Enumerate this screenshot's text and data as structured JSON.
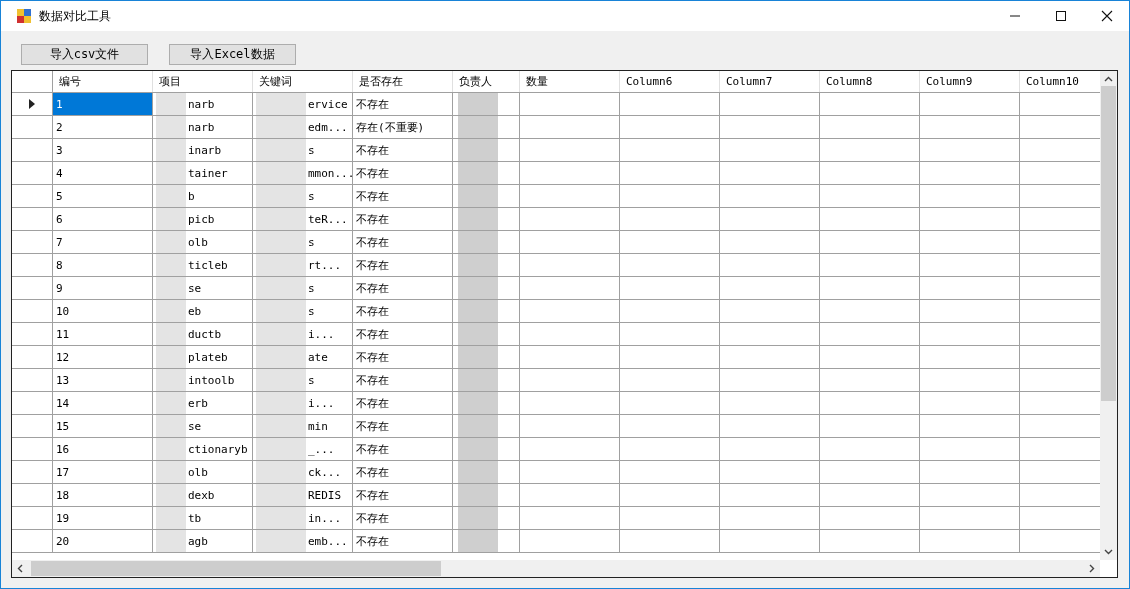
{
  "window": {
    "title": "数据对比工具"
  },
  "buttons": [
    "导入csv文件",
    "导入Excel数据"
  ],
  "table": {
    "columns": [
      "编号",
      "项目",
      "关键词",
      "是否存在",
      "负责人",
      "数量",
      "Column6",
      "Column7",
      "Column8",
      "Column9",
      "Column10"
    ],
    "rows": [
      {
        "id": "1",
        "item": "narb",
        "keyword": "ervice",
        "status": "不存在",
        "selected": true
      },
      {
        "id": "2",
        "item": "narb",
        "keyword": "edm...",
        "status": "存在(不重要)",
        "selected": false
      },
      {
        "id": "3",
        "item": "inarb",
        "keyword": "s",
        "status": "不存在",
        "selected": false
      },
      {
        "id": "4",
        "item": "tainer",
        "keyword": "mmon...",
        "status": "不存在",
        "selected": false
      },
      {
        "id": "5",
        "item": "b",
        "keyword": "s",
        "status": "不存在",
        "selected": false
      },
      {
        "id": "6",
        "item": "picb",
        "keyword": "teR...",
        "status": "不存在",
        "selected": false
      },
      {
        "id": "7",
        "item": "olb",
        "keyword": "s",
        "status": "不存在",
        "selected": false
      },
      {
        "id": "8",
        "item": "ticleb",
        "keyword": "rt...",
        "status": "不存在",
        "selected": false
      },
      {
        "id": "9",
        "item": "se",
        "keyword": "s",
        "status": "不存在",
        "selected": false
      },
      {
        "id": "10",
        "item": "eb",
        "keyword": "s",
        "status": "不存在",
        "selected": false
      },
      {
        "id": "11",
        "item": "ductb",
        "keyword": "i...",
        "status": "不存在",
        "selected": false
      },
      {
        "id": "12",
        "item": "plateb",
        "keyword": "ate",
        "status": "不存在",
        "selected": false
      },
      {
        "id": "13",
        "item": "intoolb",
        "keyword": "s",
        "status": "不存在",
        "selected": false
      },
      {
        "id": "14",
        "item": "erb",
        "keyword": "i...",
        "status": "不存在",
        "selected": false
      },
      {
        "id": "15",
        "item": "se",
        "keyword": "min",
        "status": "不存在",
        "selected": false
      },
      {
        "id": "16",
        "item": "ctionaryb",
        "keyword": "_...",
        "status": "不存在",
        "selected": false
      },
      {
        "id": "17",
        "item": "olb",
        "keyword": "ck...",
        "status": "不存在",
        "selected": false
      },
      {
        "id": "18",
        "item": "dexb",
        "keyword": "REDIS",
        "status": "不存在",
        "selected": false
      },
      {
        "id": "19",
        "item": "tb",
        "keyword": "in...",
        "status": "不存在",
        "selected": false
      },
      {
        "id": "20",
        "item": "agb",
        "keyword": "emb...",
        "status": "不存在",
        "selected": false
      }
    ]
  }
}
